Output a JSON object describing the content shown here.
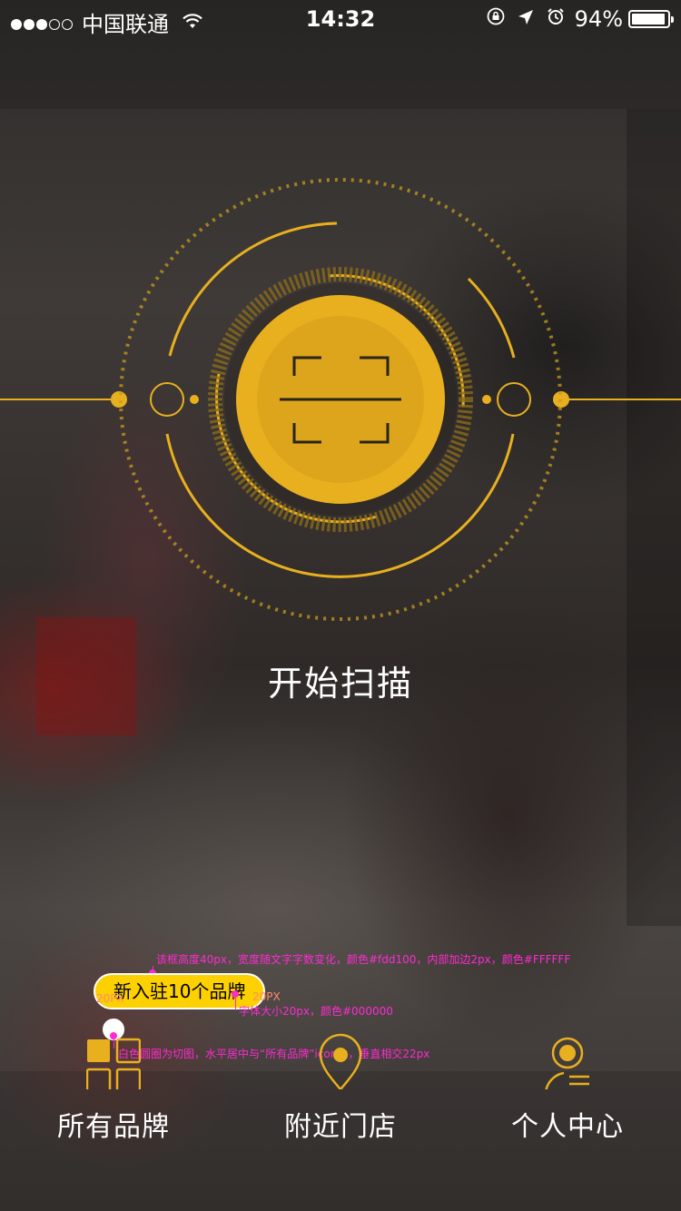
{
  "status_bar": {
    "carrier": "中国联通",
    "time": "14:32",
    "battery": "94%",
    "battery_level": 0.94,
    "signal_bars_filled": 3,
    "signal_bars_total": 5
  },
  "scanner": {
    "label": "开始扫描",
    "icon": "scan-icon"
  },
  "badge": {
    "text": "新入驻10个品牌",
    "bg_color": "#fdd100",
    "border_color": "#FFFFFF",
    "text_color": "#000000"
  },
  "annotations": {
    "badge_spec": "该框高度40px，宽度随文字字数变化，颜色#fdd100，内部加边2px，颜色#FFFFFF",
    "padding_left": "20PX",
    "padding_right": "20PX",
    "font_spec": "字体大小20px，颜色#000000",
    "circle_spec": "白色圆圈为切图，水平居中与“所有品牌”icon中，垂直相交22px"
  },
  "nav": {
    "items": [
      {
        "label": "所有品牌",
        "icon": "grid-icon"
      },
      {
        "label": "附近门店",
        "icon": "location-pin-icon"
      },
      {
        "label": "个人中心",
        "icon": "user-icon"
      }
    ]
  },
  "colors": {
    "accent": "#e8b01f",
    "white": "#ffffff",
    "annotation": "#ff2ad1"
  }
}
